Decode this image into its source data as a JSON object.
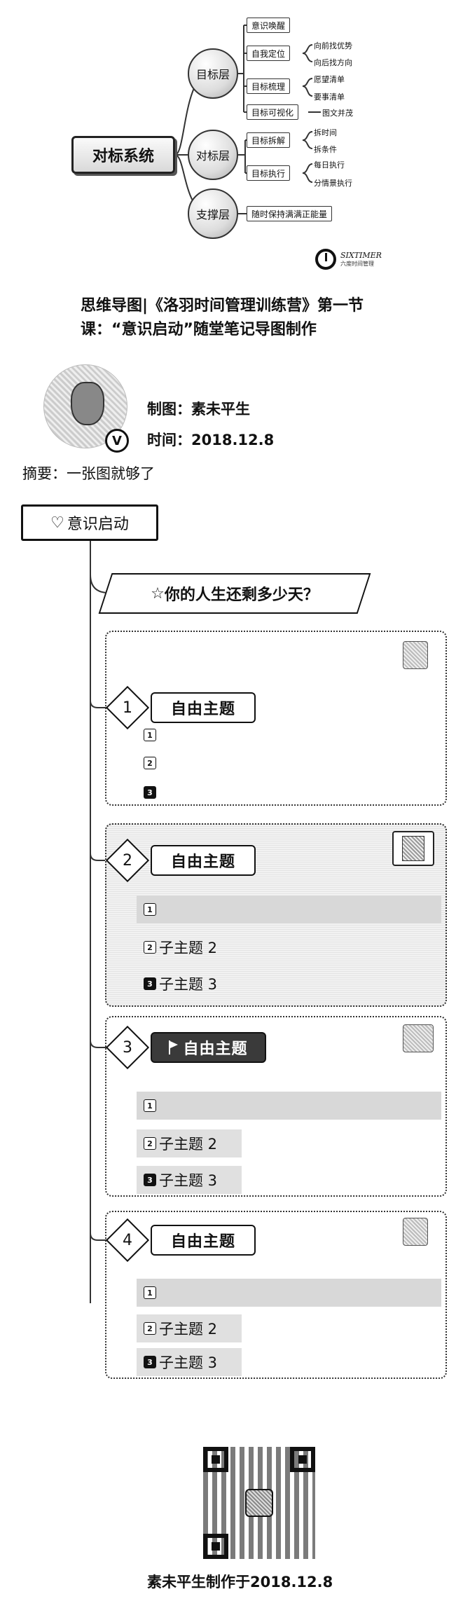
{
  "mindmap": {
    "root": "对标系统",
    "layers": [
      "目标层",
      "对标层",
      "支撑层"
    ],
    "nodes": {
      "awake": "意识唤醒",
      "self_position": "自我定位",
      "goal_sort": "目标梳理",
      "goal_visual": "目标可视化",
      "goal_split": "目标拆解",
      "goal_exec": "目标执行",
      "support": "随时保持满满正能量"
    },
    "leaves": {
      "sp1": "向前找优势",
      "sp2": "向后找方向",
      "gs1": "愿望清单",
      "gs2": "要事清单",
      "gv1": "图文并茂",
      "split1": "拆时间",
      "split2": "拆条件",
      "exec1": "每日执行",
      "exec2": "分情景执行"
    },
    "logo_text": "SIXTIMER",
    "logo_sub": "六度时间管理"
  },
  "title_line1": "思维导图|《洛羽时间管理训练营》第一节",
  "title_line2": "课：“意识启动”随堂笔记导图制作",
  "avatar_badge": "V",
  "author": "制图：素未平生",
  "date": "时间：2018.12.8",
  "summary": "摘要：一张图就够了",
  "outline": {
    "root_icon": "♡",
    "root": "意识启动",
    "question_icon": "☆",
    "question": "你的人生还剩多少天？",
    "theme": "自由主题",
    "sub2": "子主题 2",
    "sub3": "子主题 3",
    "n1": "1",
    "n2": "2",
    "n3": "3",
    "n4": "4",
    "i1": "1",
    "i2": "2",
    "i3": "3"
  },
  "footer": "素未平生制作于2018.12.8"
}
